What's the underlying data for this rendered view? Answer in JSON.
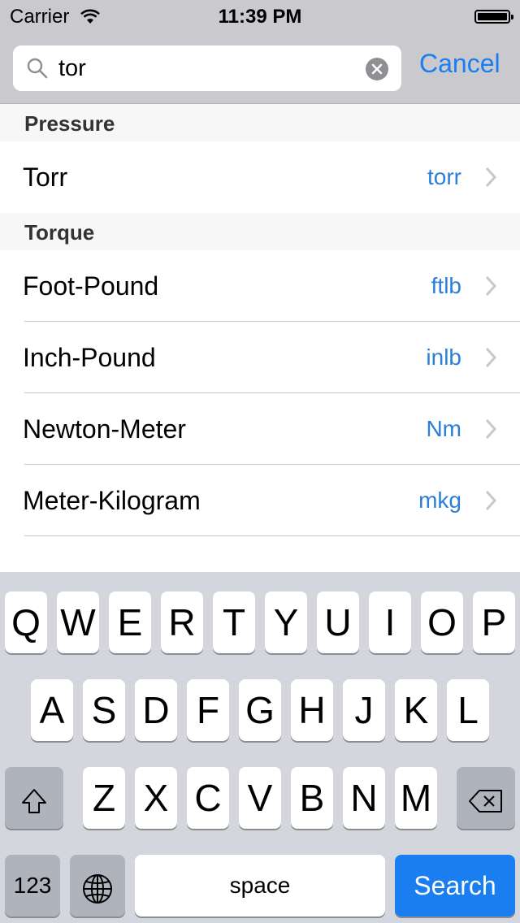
{
  "status": {
    "carrier": "Carrier",
    "time": "11:39 PM"
  },
  "search": {
    "value": "tor",
    "cancel_label": "Cancel"
  },
  "sections": [
    {
      "header": "Pressure",
      "rows": [
        {
          "label": "Torr",
          "unit": "torr"
        }
      ]
    },
    {
      "header": "Torque",
      "rows": [
        {
          "label": "Foot-Pound",
          "unit": "ftlb"
        },
        {
          "label": "Inch-Pound",
          "unit": "inlb"
        },
        {
          "label": "Newton-Meter",
          "unit": "Nm"
        },
        {
          "label": "Meter-Kilogram",
          "unit": "mkg"
        }
      ]
    }
  ],
  "keyboard": {
    "row1": [
      "Q",
      "W",
      "E",
      "R",
      "T",
      "Y",
      "U",
      "I",
      "O",
      "P"
    ],
    "row2": [
      "A",
      "S",
      "D",
      "F",
      "G",
      "H",
      "J",
      "K",
      "L"
    ],
    "row3": [
      "Z",
      "X",
      "C",
      "V",
      "B",
      "N",
      "M"
    ],
    "numbers_label": "123",
    "space_label": "space",
    "search_label": "Search",
    "shift_icon": "shift-icon",
    "delete_icon": "delete-icon",
    "globe_icon": "globe-icon"
  },
  "colors": {
    "accent": "#1a7ef0",
    "unit_text": "#2a7fd8"
  }
}
